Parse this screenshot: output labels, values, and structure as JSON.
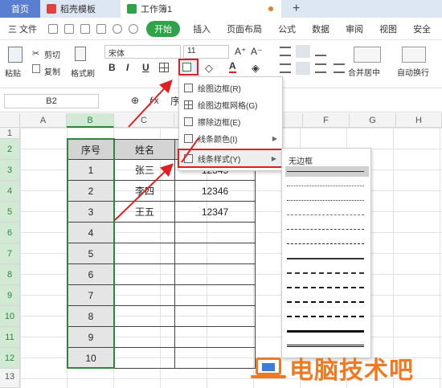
{
  "tabs": {
    "home": "首页",
    "template": "稻壳模板",
    "workbook": "工作簿1",
    "new_tab": "+"
  },
  "menu": {
    "file": "三 文件",
    "start": "开始",
    "items": [
      "插入",
      "页面布局",
      "公式",
      "数据",
      "审阅",
      "视图",
      "安全"
    ]
  },
  "ribbon": {
    "paste": "粘贴",
    "cut": "剪切",
    "copy": "复制",
    "format_painter": "格式刷",
    "font_name": "宋体",
    "font_size": "11",
    "bold": "B",
    "italic": "I",
    "underline": "U",
    "font_color_letter": "A",
    "merge_center": "合并居中",
    "auto_wrap": "自动换行"
  },
  "name_box": "B2",
  "formula_text": "序",
  "columns": [
    "A",
    "B",
    "C",
    "D",
    "E",
    "F",
    "G",
    "H"
  ],
  "rows": [
    "1",
    "2",
    "3",
    "4",
    "5",
    "6",
    "7",
    "8",
    "9",
    "10",
    "11",
    "12",
    "13"
  ],
  "table": {
    "headers": [
      "序号",
      "姓名"
    ],
    "serials": [
      "1",
      "2",
      "3",
      "4",
      "5",
      "6",
      "7",
      "8",
      "9",
      "10"
    ],
    "names": [
      "张三",
      "李四",
      "王五"
    ],
    "numbers": [
      "12345",
      "12346",
      "12347"
    ]
  },
  "border_menu": {
    "items": [
      "绘图边框(R)",
      "绘图边框网格(G)",
      "擦除边框(E)",
      "线条颜色(I)",
      "线条样式(Y)"
    ]
  },
  "line_styles": {
    "none": "无边框"
  },
  "watermark": "电脑技术吧",
  "colors": {
    "selection": "#2e8540",
    "highlight": "#e02020",
    "accent": "#2fa34a",
    "watermark": "#f07a22"
  }
}
